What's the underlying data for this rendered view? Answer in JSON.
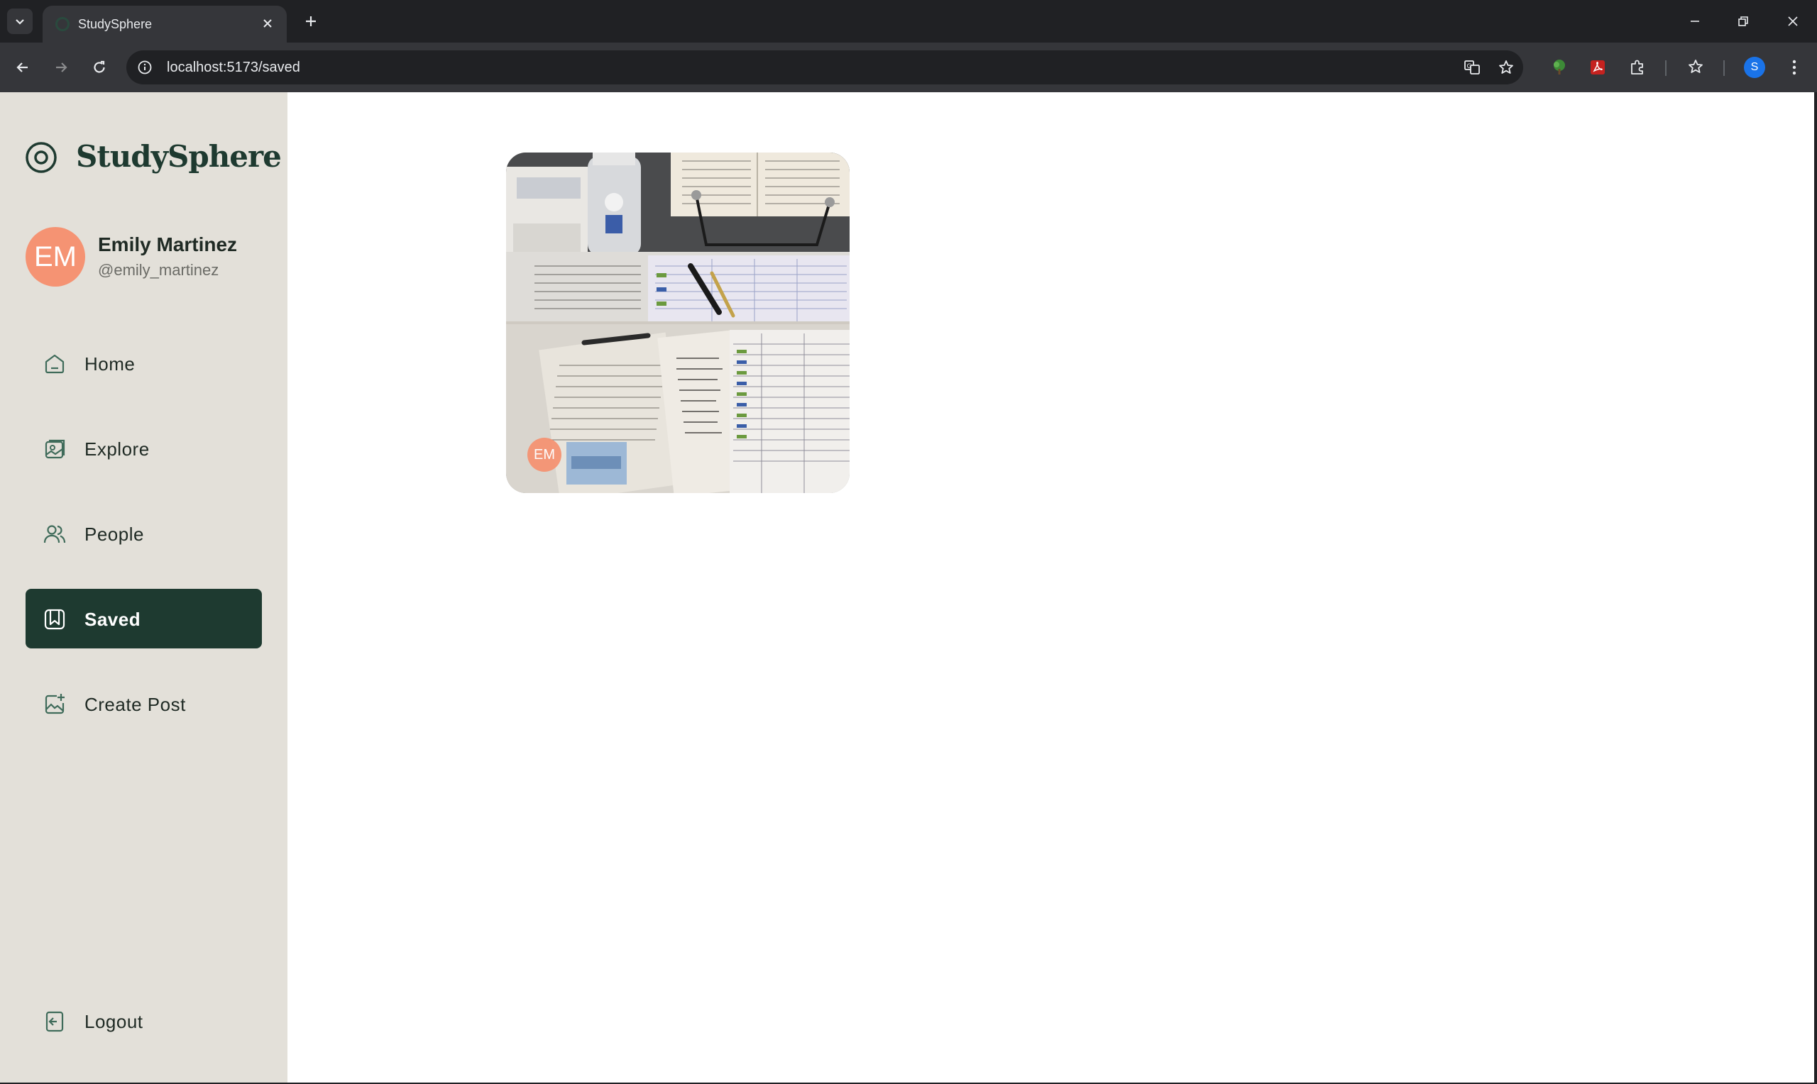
{
  "browser": {
    "tab_title": "StudySphere",
    "url": "localhost:5173/saved",
    "profile_initial": "S"
  },
  "app": {
    "brand": "StudySphere",
    "user": {
      "initials": "EM",
      "name": "Emily Martinez",
      "handle": "@emily_martinez"
    },
    "nav": [
      {
        "label": "Home",
        "icon": "home-icon",
        "active": false
      },
      {
        "label": "Explore",
        "icon": "image-gallery-icon",
        "active": false
      },
      {
        "label": "People",
        "icon": "people-icon",
        "active": false
      },
      {
        "label": "Saved",
        "icon": "bookmark-icon",
        "active": true
      },
      {
        "label": "Create Post",
        "icon": "add-image-icon",
        "active": false
      }
    ],
    "logout_label": "Logout",
    "saved_posts": [
      {
        "image": "study-desk-notes-photo",
        "author_initials": "EM"
      }
    ]
  },
  "colors": {
    "sidebar_bg": "#e3e0d9",
    "brand_dark_green": "#1e3a30",
    "avatar_orange": "#f59373",
    "content_bg": "#ffffff"
  }
}
